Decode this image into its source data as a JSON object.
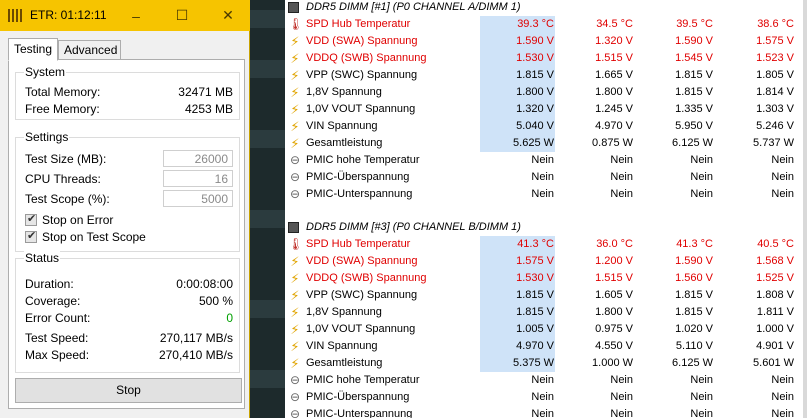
{
  "etr": {
    "title": "ETR: 01:12:11",
    "min_glyph": "–",
    "max_glyph": "☐",
    "close_glyph": "✕",
    "tabs": [
      "Testing",
      "Advanced"
    ],
    "system": {
      "title": "System",
      "total_memory_label": "Total Memory:",
      "total_memory_value": "32471 MB",
      "free_memory_label": "Free Memory:",
      "free_memory_value": "4253 MB"
    },
    "settings": {
      "title": "Settings",
      "test_size_label": "Test Size (MB):",
      "test_size_value": "26000",
      "cpu_threads_label": "CPU Threads:",
      "cpu_threads_value": "16",
      "test_scope_label": "Test Scope (%):",
      "test_scope_value": "5000",
      "stop_on_error_label": "Stop on Error",
      "stop_on_scope_label": "Stop on Test Scope",
      "check_glyph": "✔"
    },
    "status": {
      "title": "Status",
      "duration_label": "Duration:",
      "duration_value": "0:00:08:00",
      "coverage_label": "Coverage:",
      "coverage_value": "500 %",
      "error_count_label": "Error Count:",
      "error_count_value": "0",
      "test_speed_label": "Test Speed:",
      "test_speed_value": "270,117 MB/s",
      "max_speed_label": "Max Speed:",
      "max_speed_value": "270,410 MB/s"
    },
    "stop_button": "Stop",
    "colors": {
      "titlebar": "#f6c400",
      "error_count": "#00a000"
    }
  },
  "sensors": {
    "icons": {
      "thermometer": "🌡",
      "bolt": "⚡",
      "circle": "⊖"
    },
    "groups": [
      {
        "header": "DDR5 DIMM [#1] (P0 CHANNEL A/DIMM 1)",
        "rows": [
          {
            "icon": "thermometer",
            "name": "SPD Hub Temperatur",
            "red": true,
            "values": [
              "39.3 °C",
              "34.5 °C",
              "39.5 °C",
              "38.6 °C"
            ]
          },
          {
            "icon": "bolt",
            "name": "VDD (SWA) Spannung",
            "red": true,
            "values": [
              "1.590 V",
              "1.320 V",
              "1.590 V",
              "1.575 V"
            ]
          },
          {
            "icon": "bolt",
            "name": "VDDQ (SWB) Spannung",
            "red": true,
            "values": [
              "1.530 V",
              "1.515 V",
              "1.545 V",
              "1.523 V"
            ]
          },
          {
            "icon": "bolt",
            "name": "VPP (SWC) Spannung",
            "red": false,
            "values": [
              "1.815 V",
              "1.665 V",
              "1.815 V",
              "1.805 V"
            ]
          },
          {
            "icon": "bolt",
            "name": "1,8V Spannung",
            "red": false,
            "values": [
              "1.800 V",
              "1.800 V",
              "1.815 V",
              "1.814 V"
            ]
          },
          {
            "icon": "bolt",
            "name": "1,0V VOUT Spannung",
            "red": false,
            "values": [
              "1.320 V",
              "1.245 V",
              "1.335 V",
              "1.303 V"
            ]
          },
          {
            "icon": "bolt",
            "name": "VIN Spannung",
            "red": false,
            "values": [
              "5.040 V",
              "4.970 V",
              "5.950 V",
              "5.246 V"
            ]
          },
          {
            "icon": "bolt",
            "name": "Gesamtleistung",
            "red": false,
            "values": [
              "5.625 W",
              "0.875 W",
              "6.125 W",
              "5.737 W"
            ]
          },
          {
            "icon": "circle",
            "name": "PMIC hohe Temperatur",
            "red": false,
            "values": [
              "Nein",
              "Nein",
              "Nein",
              "Nein"
            ]
          },
          {
            "icon": "circle",
            "name": "PMIC-Überspannung",
            "red": false,
            "values": [
              "Nein",
              "Nein",
              "Nein",
              "Nein"
            ]
          },
          {
            "icon": "circle",
            "name": "PMIC-Unterspannung",
            "red": false,
            "values": [
              "Nein",
              "Nein",
              "Nein",
              "Nein"
            ]
          }
        ]
      },
      {
        "header": "DDR5 DIMM [#3] (P0 CHANNEL B/DIMM 1)",
        "rows": [
          {
            "icon": "thermometer",
            "name": "SPD Hub Temperatur",
            "red": true,
            "values": [
              "41.3 °C",
              "36.0 °C",
              "41.3 °C",
              "40.5 °C"
            ]
          },
          {
            "icon": "bolt",
            "name": "VDD (SWA) Spannung",
            "red": true,
            "values": [
              "1.575 V",
              "1.200 V",
              "1.590 V",
              "1.568 V"
            ]
          },
          {
            "icon": "bolt",
            "name": "VDDQ (SWB) Spannung",
            "red": true,
            "values": [
              "1.530 V",
              "1.515 V",
              "1.560 V",
              "1.525 V"
            ]
          },
          {
            "icon": "bolt",
            "name": "VPP (SWC) Spannung",
            "red": false,
            "values": [
              "1.815 V",
              "1.605 V",
              "1.815 V",
              "1.808 V"
            ]
          },
          {
            "icon": "bolt",
            "name": "1,8V Spannung",
            "red": false,
            "values": [
              "1.815 V",
              "1.800 V",
              "1.815 V",
              "1.811 V"
            ]
          },
          {
            "icon": "bolt",
            "name": "1,0V VOUT Spannung",
            "red": false,
            "values": [
              "1.005 V",
              "0.975 V",
              "1.020 V",
              "1.000 V"
            ]
          },
          {
            "icon": "bolt",
            "name": "VIN Spannung",
            "red": false,
            "values": [
              "4.970 V",
              "4.550 V",
              "5.110 V",
              "4.901 V"
            ]
          },
          {
            "icon": "bolt",
            "name": "Gesamtleistung",
            "red": false,
            "values": [
              "5.375 W",
              "1.000 W",
              "6.125 W",
              "5.601 W"
            ]
          },
          {
            "icon": "circle",
            "name": "PMIC hohe Temperatur",
            "red": false,
            "values": [
              "Nein",
              "Nein",
              "Nein",
              "Nein"
            ]
          },
          {
            "icon": "circle",
            "name": "PMIC-Überspannung",
            "red": false,
            "values": [
              "Nein",
              "Nein",
              "Nein",
              "Nein"
            ]
          },
          {
            "icon": "circle",
            "name": "PMIC-Unterspannung",
            "red": false,
            "values": [
              "Nein",
              "Nein",
              "Nein",
              "Nein"
            ]
          }
        ]
      }
    ]
  }
}
